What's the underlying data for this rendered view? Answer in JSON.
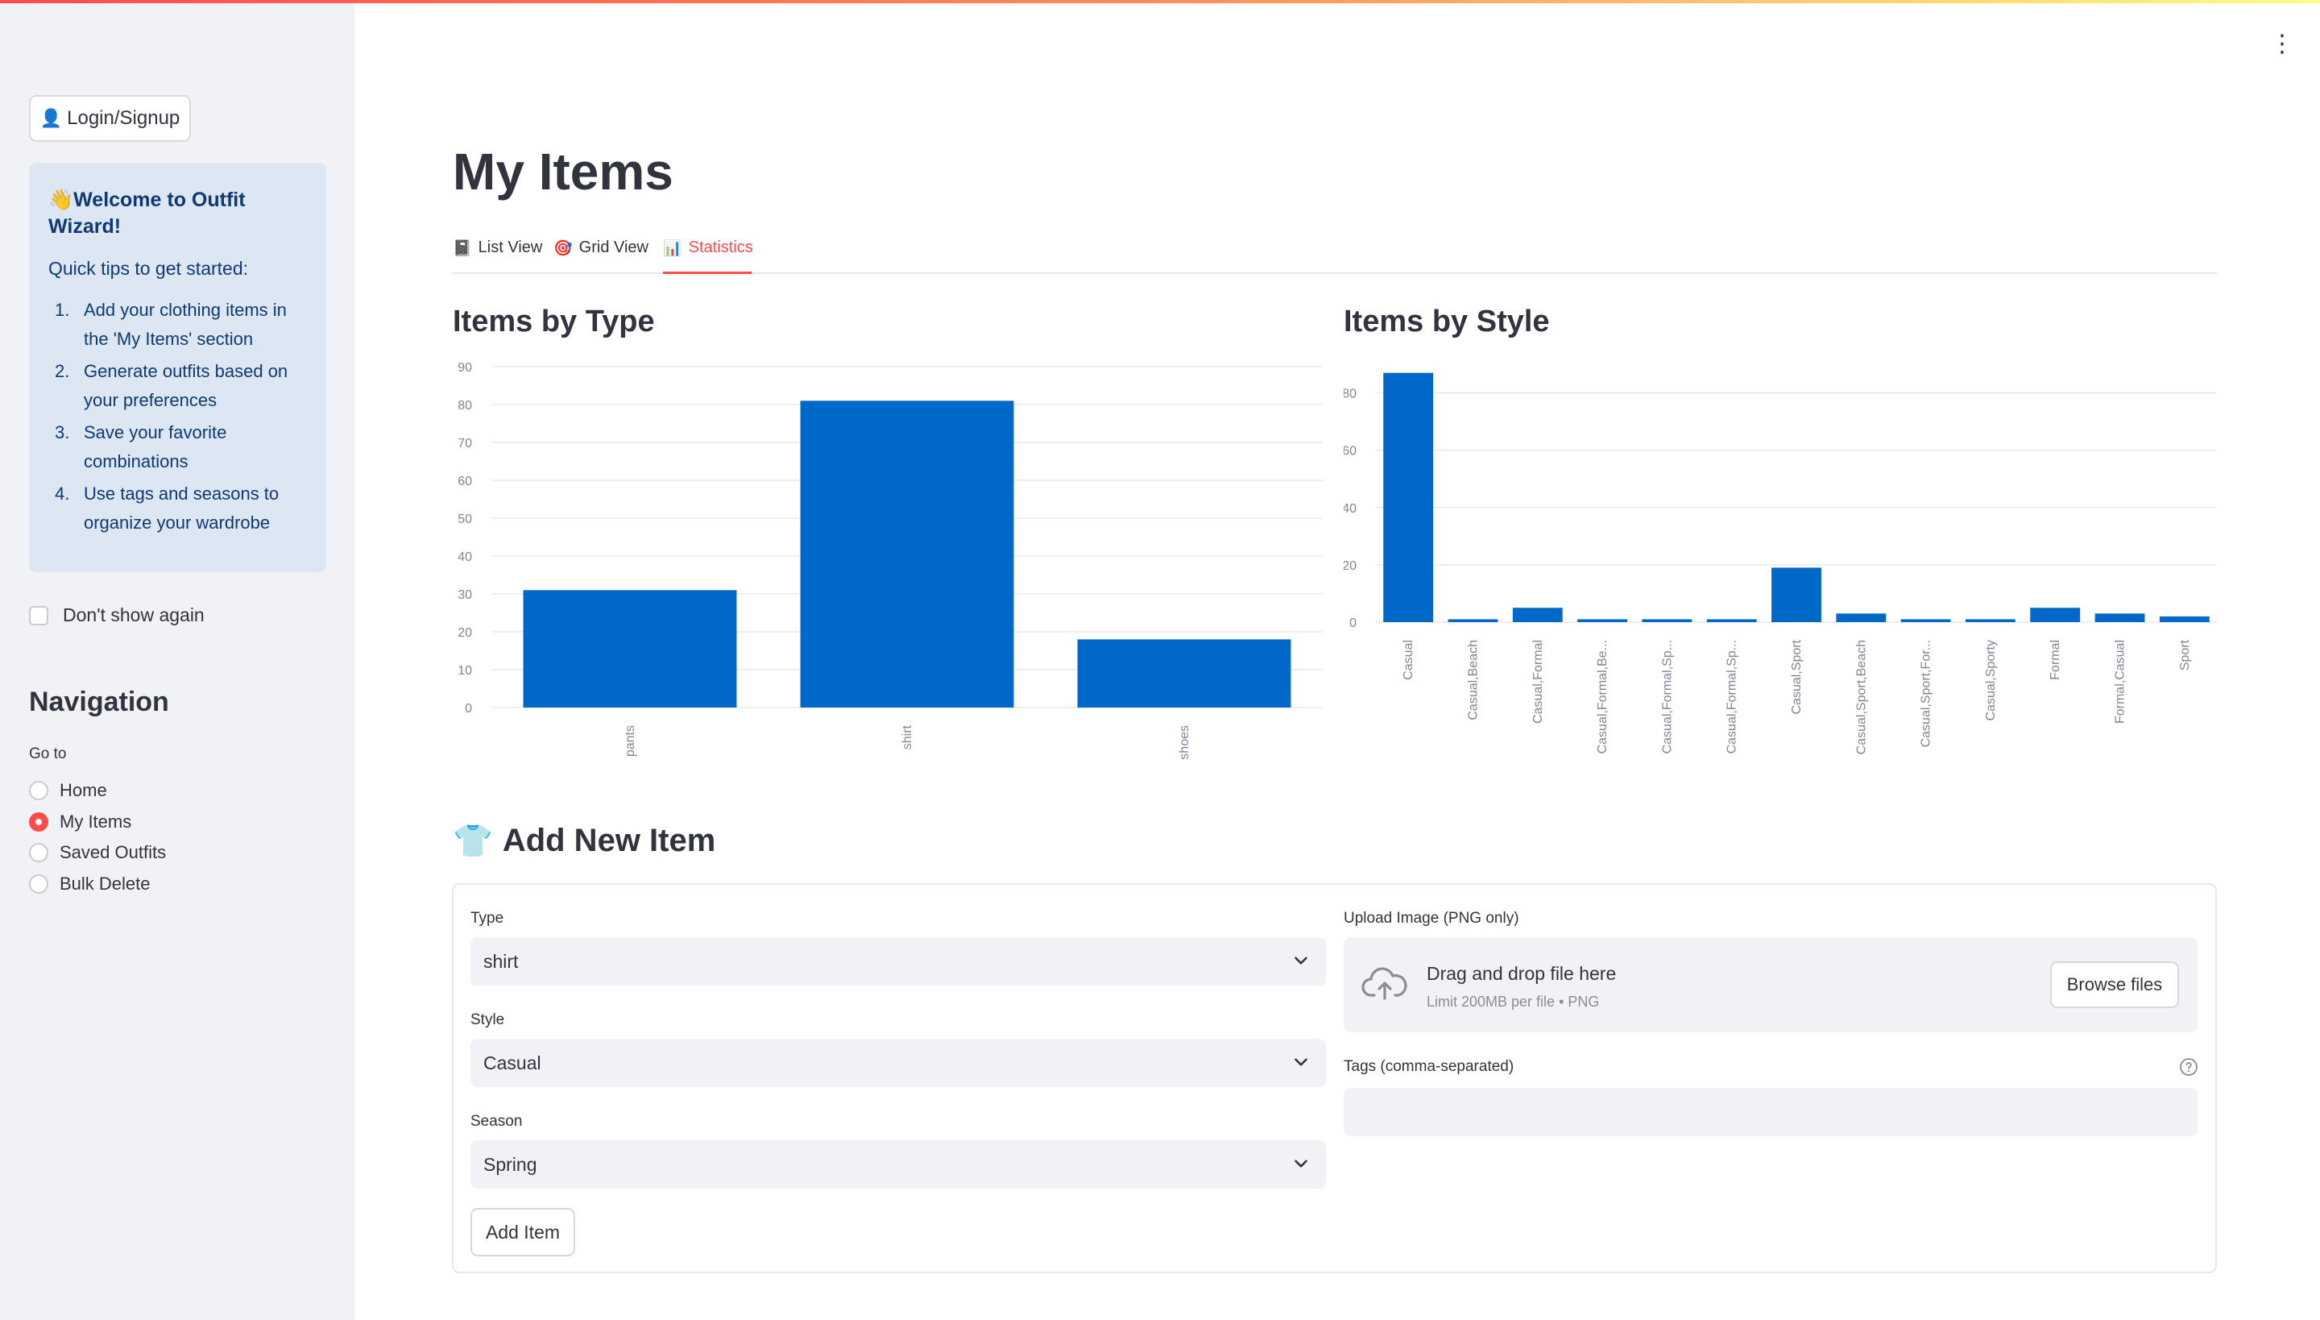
{
  "sidebar": {
    "login_label": "Login/Signup",
    "welcome": {
      "title": "Welcome to Outfit Wizard!",
      "subtitle": "Quick tips to get started:",
      "tips": [
        {
          "num": "1.",
          "text": "Add your clothing items in the 'My Items' section"
        },
        {
          "num": "2.",
          "text": "Generate outfits based on your preferences"
        },
        {
          "num": "3.",
          "text": "Save your favorite combinations"
        },
        {
          "num": "4.",
          "text": "Use tags and seasons to organize your wardrobe"
        }
      ]
    },
    "dont_show_label": "Don't show again",
    "nav_title": "Navigation",
    "goto_label": "Go to",
    "nav_options": [
      "Home",
      "My Items",
      "Saved Outfits",
      "Bulk Delete"
    ],
    "nav_selected": "My Items"
  },
  "main": {
    "title": "My Items",
    "tabs": [
      {
        "label": "List View",
        "icon": "notepad-icon"
      },
      {
        "label": "Grid View",
        "icon": "target-icon"
      },
      {
        "label": "Statistics",
        "icon": "bar-chart-icon"
      }
    ],
    "active_tab": "Statistics"
  },
  "charts": {
    "type_title": "Items by Type",
    "style_title": "Items by Style"
  },
  "chart_data": [
    {
      "type": "bar",
      "title": "Items by Type",
      "categories": [
        "pants",
        "shirt",
        "shoes"
      ],
      "values": [
        31,
        81,
        18
      ],
      "ylim": [
        0,
        90
      ],
      "yticks": [
        0,
        10,
        20,
        30,
        40,
        50,
        60,
        70,
        80,
        90
      ],
      "grid": true,
      "color": "#0068c9"
    },
    {
      "type": "bar",
      "title": "Items by Style",
      "categories": [
        "Casual",
        "Casual,Beach",
        "Casual,Formal",
        "Casual,Formal,Be...",
        "Casual,Formal,Sp...",
        "Casual,Formal,Sp...",
        "Casual,Sport",
        "Casual,Sport,Beach",
        "Casual,Sport,For...",
        "Casual,Sporty",
        "Formal",
        "Formal,Casual",
        "Sport"
      ],
      "values": [
        87,
        1,
        5,
        1,
        1,
        1,
        19,
        3,
        1,
        1,
        5,
        3,
        2
      ],
      "ylim": [
        0,
        90
      ],
      "yticks": [
        0,
        20,
        40,
        60,
        80
      ],
      "grid": true,
      "color": "#0068c9"
    }
  ],
  "form": {
    "section_title": "Add New Item",
    "section_icon": "shirt-icon",
    "type_label": "Type",
    "type_value": "shirt",
    "style_label": "Style",
    "style_value": "Casual",
    "season_label": "Season",
    "season_value": "Spring",
    "add_button": "Add Item",
    "upload_label": "Upload Image (PNG only)",
    "upload_main": "Drag and drop file here",
    "upload_sub": "Limit 200MB per file • PNG",
    "browse_button": "Browse files",
    "tags_label": "Tags (comma-separated)",
    "tags_value": ""
  }
}
